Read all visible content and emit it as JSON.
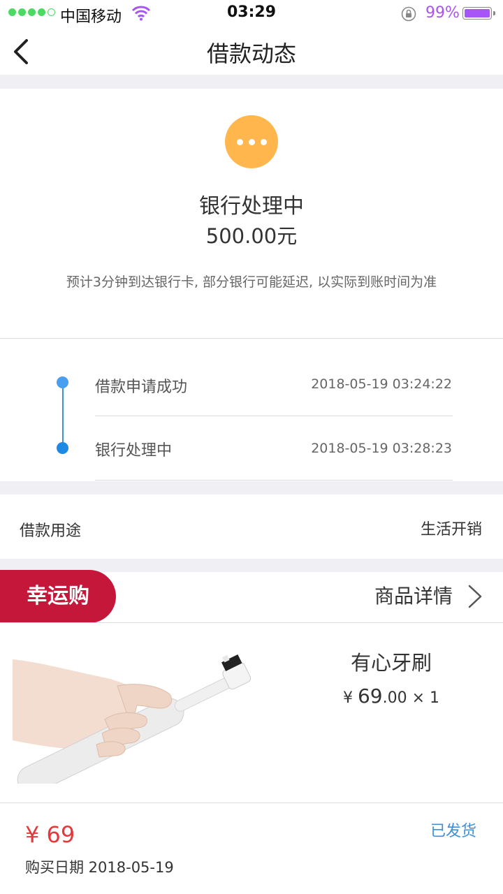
{
  "status_bar": {
    "carrier": "中国移动",
    "time": "03:29",
    "battery": "99%",
    "battery_color": "#a855f7"
  },
  "nav": {
    "title": "借款动态",
    "back_icon": "chevron-left-icon"
  },
  "loan_status": {
    "icon": "more-dots-icon",
    "icon_color": "#ffb74d",
    "status": "银行处理中",
    "amount": "500.00元",
    "note": "预计3分钟到达银行卡, 部分银行可能延迟, 以实际到账时间为准"
  },
  "timeline": [
    {
      "label": "借款申请成功",
      "time": "2018-05-19 03:24:22"
    },
    {
      "label": "银行处理中",
      "time": "2018-05-19 03:28:23"
    }
  ],
  "purpose": {
    "label": "借款用途",
    "value": "生活开销"
  },
  "lucky_buy": {
    "badge": "幸运购",
    "detail_link": "商品详情",
    "product": {
      "name": "有心牙刷",
      "currency": "¥",
      "price_int": "69",
      "price_dec": ".00",
      "qty": "× 1"
    },
    "total": "¥ 69",
    "purchase_date": "购买日期 2018-05-19",
    "shipping_status": "已发货"
  }
}
